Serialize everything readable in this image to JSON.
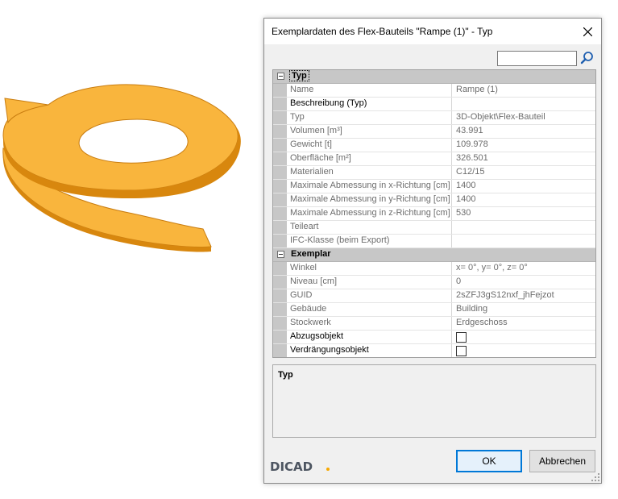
{
  "dialog": {
    "title": "Exemplardaten des Flex-Bauteils \"Rampe (1)\" - Typ",
    "search_value": ""
  },
  "grid": {
    "categories": [
      {
        "label": "Typ",
        "rows": [
          {
            "name": "Name",
            "value": "Rampe (1)",
            "editable": false
          },
          {
            "name": "Beschreibung (Typ)",
            "value": "",
            "editable": true
          },
          {
            "name": "Typ",
            "value": "3D-Objekt\\Flex-Bauteil",
            "editable": false
          },
          {
            "name": "Volumen [m³]",
            "value": "43.991",
            "editable": false
          },
          {
            "name": "Gewicht [t]",
            "value": "109.978",
            "editable": false
          },
          {
            "name": "Oberfläche [m²]",
            "value": "326.501",
            "editable": false
          },
          {
            "name": "Materialien",
            "value": "C12/15",
            "editable": false
          },
          {
            "name": "Maximale Abmessung in x-Richtung [cm]",
            "value": "1400",
            "editable": false
          },
          {
            "name": "Maximale Abmessung in y-Richtung [cm]",
            "value": "1400",
            "editable": false
          },
          {
            "name": "Maximale Abmessung in z-Richtung [cm]",
            "value": "530",
            "editable": false
          },
          {
            "name": "Teileart",
            "value": "",
            "editable": false
          },
          {
            "name": "IFC-Klasse (beim Export)",
            "value": "",
            "editable": false
          }
        ]
      },
      {
        "label": "Exemplar",
        "rows": [
          {
            "name": "Winkel",
            "value": "x= 0°, y= 0°, z= 0°",
            "editable": false
          },
          {
            "name": "Niveau [cm]",
            "value": "0",
            "editable": false
          },
          {
            "name": "GUID",
            "value": "2sZFJ3gS12nxf_jhFejzot",
            "editable": false
          },
          {
            "name": "Gebäude",
            "value": "Building",
            "editable": false
          },
          {
            "name": "Stockwerk",
            "value": "Erdgeschoss",
            "editable": false
          },
          {
            "name": "Abzugsobjekt",
            "checkbox": true,
            "checked": false,
            "editable": true
          },
          {
            "name": "Verdrängungsobjekt",
            "checkbox": true,
            "checked": false,
            "editable": true
          }
        ]
      }
    ]
  },
  "description": {
    "title": "Typ"
  },
  "buttons": {
    "ok": "OK",
    "cancel": "Abbrechen"
  },
  "logo": {
    "text": "DICAD",
    "accent": "#f7a800"
  },
  "icons": {
    "close": "close-icon",
    "search": "search-icon",
    "collapse": "collapse-icon"
  },
  "colors": {
    "ramp": "#f9b53d",
    "ramp_edge": "#d8870e",
    "focus": "#0078d7"
  }
}
